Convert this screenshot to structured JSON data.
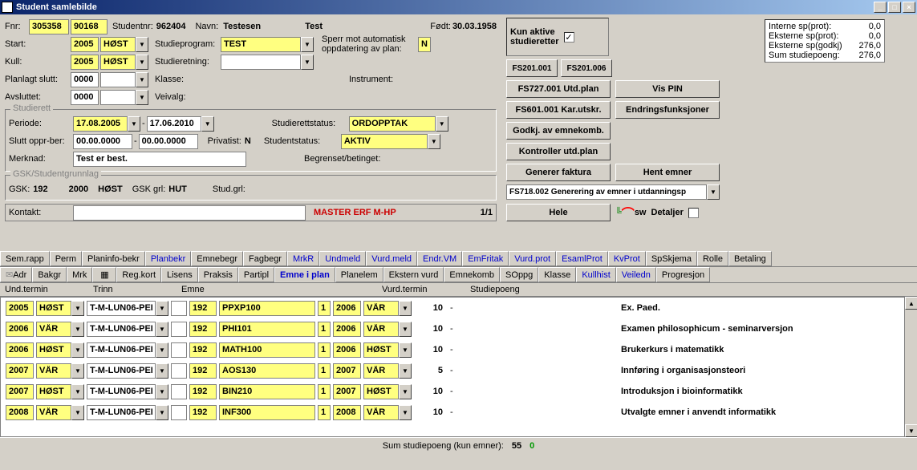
{
  "window": {
    "title": "Student samlebilde"
  },
  "header": {
    "fnr_label": "Fnr:",
    "fnr1": "305358",
    "fnr2": "90168",
    "studentnr_label": "Studentnr:",
    "studentnr": "962404",
    "navn_label": "Navn:",
    "etternavn": "Testesen",
    "fornavn": "Test",
    "fodt_label": "Født:",
    "fodt": "30.03.1958",
    "start_label": "Start:",
    "start_year": "2005",
    "start_term": "HØST",
    "studieprogram_label": "Studieprogram:",
    "studieprogram": "TEST",
    "sperr_label": "Sperr mot automatisk oppdatering av plan:",
    "sperr_val": "N",
    "kull_label": "Kull:",
    "kull_year": "2005",
    "kull_term": "HØST",
    "studieretning_label": "Studieretning:",
    "planlagt_label": "Planlagt slutt:",
    "planlagt_year": "0000",
    "klasse_label": "Klasse:",
    "instrument_label": "Instrument:",
    "avsluttet_label": "Avsluttet:",
    "avsluttet_year": "0000",
    "veivalg_label": "Veivalg:"
  },
  "studierett": {
    "legend": "Studierett",
    "periode_label": "Periode:",
    "periode_from": "17.08.2005",
    "periode_to": "17.06.2010",
    "studierettstatus_label": "Studierettstatus:",
    "studierettstatus": "ORDOPPTAK",
    "slutt_label": "Slutt oppr-ber:",
    "slutt_from": "00.00.0000",
    "slutt_to": "00.00.0000",
    "privatist_label": "Privatist:",
    "privatist": "N",
    "studentstatus_label": "Studentstatus:",
    "studentstatus": "AKTIV",
    "merknad_label": "Merknad:",
    "merknad": "Test er best.",
    "begrenset_label": "Begrenset/betinget:"
  },
  "gsk": {
    "legend": "GSK/Studentgrunnlag",
    "gsk_label": "GSK:",
    "gsk_val": "192",
    "gsk_year": "2000",
    "gsk_term": "HØST",
    "gsk_grl_label": "GSK grl:",
    "gsk_grl": "HUT",
    "stud_grl_label": "Stud.grl:"
  },
  "kontakt": {
    "label": "Kontakt:",
    "master": "MASTER ERF M-HP",
    "count": "1/1"
  },
  "kun_aktive": {
    "label1": "Kun aktive",
    "label2": "studieretter",
    "checked": "✓"
  },
  "stats": {
    "interne_sp_prot": "Interne sp(prot):",
    "interne_val": "0,0",
    "eksterne_sp_prot": "Eksterne sp(prot):",
    "eksterne_prot_val": "0,0",
    "eksterne_sp_godkj": "Eksterne sp(godkj)",
    "eksterne_godkj_val": "276,0",
    "sum_label": "Sum studiepoeng:",
    "sum_val": "276,0"
  },
  "buttons": {
    "fs201_001": "FS201.001",
    "fs201_006": "FS201.006",
    "fs727": "FS727.001 Utd.plan",
    "vis_pin": "Vis PIN",
    "fs601": "FS601.001 Kar.utskr.",
    "endrings": "Endringsfunksjoner",
    "godkj": "Godkj. av emnekomb.",
    "kontroller": "Kontroller utd.plan",
    "generer_faktura": "Generer faktura",
    "hent_emner": "Hent emner",
    "fs718": "FS718.002 Generering av emner i utdanningsp",
    "hele": "Hele",
    "detaljer": "Detaljer"
  },
  "tabs1": [
    "Sem.rapp",
    "Perm",
    "Planinfo-bekr",
    "Planbekr",
    "Emnebegr",
    "Fagbegr",
    "MrkR",
    "Undmeld",
    "Vurd.meld",
    "Endr.VM",
    "EmFritak",
    "Vurd.prot",
    "EsamlProt",
    "KvProt",
    "SpSkjema",
    "Rolle",
    "Betaling"
  ],
  "tabs1_blue": [
    3,
    6,
    7,
    8,
    9,
    10,
    11,
    12,
    13
  ],
  "tabs2_pre": "Adr",
  "tabs2": [
    "Bakgr",
    "Mrk",
    "",
    "Reg.kort",
    "Lisens",
    "Praksis",
    "Partipl",
    "Emne i plan",
    "Planelem",
    "Ekstern vurd",
    "Emnekomb",
    "SOppg",
    "Klasse",
    "Kullhist",
    "Veiledn",
    "Progresjon"
  ],
  "tabs2_active": 7,
  "grid": {
    "headers": {
      "und_termin": "Und.termin",
      "trinn": "Trinn",
      "emne": "Emne",
      "vurd_termin": "Vurd.termin",
      "studiepoeng": "Studiepoeng"
    },
    "rows": [
      {
        "year": "2005",
        "term": "HØST",
        "trinn": "T-M-LUN06-PEI",
        "emnenum": "192",
        "emne": "PPXP100",
        "v": "1",
        "vyear": "2006",
        "vterm": "VÅR",
        "sp": "10",
        "dash": "-",
        "desc": "Ex. Paed."
      },
      {
        "year": "2006",
        "term": "VÅR",
        "trinn": "T-M-LUN06-PEI",
        "emnenum": "192",
        "emne": "PHI101",
        "v": "1",
        "vyear": "2006",
        "vterm": "VÅR",
        "sp": "10",
        "dash": "-",
        "desc": "Examen philosophicum - seminarversjon"
      },
      {
        "year": "2006",
        "term": "HØST",
        "trinn": "T-M-LUN06-PEI",
        "emnenum": "192",
        "emne": "MATH100",
        "v": "1",
        "vyear": "2006",
        "vterm": "HØST",
        "sp": "10",
        "dash": "-",
        "desc": "Brukerkurs i matematikk"
      },
      {
        "year": "2007",
        "term": "VÅR",
        "trinn": "T-M-LUN06-PEI",
        "emnenum": "192",
        "emne": "AOS130",
        "v": "1",
        "vyear": "2007",
        "vterm": "VÅR",
        "sp": "5",
        "dash": "-",
        "desc": "Innføring i organisasjonsteori"
      },
      {
        "year": "2007",
        "term": "HØST",
        "trinn": "T-M-LUN06-PEI",
        "emnenum": "192",
        "emne": "BIN210",
        "v": "1",
        "vyear": "2007",
        "vterm": "HØST",
        "sp": "10",
        "dash": "-",
        "desc": "Introduksjon i bioinformatikk"
      },
      {
        "year": "2008",
        "term": "VÅR",
        "trinn": "T-M-LUN06-PEI",
        "emnenum": "192",
        "emne": "INF300",
        "v": "1",
        "vyear": "2008",
        "vterm": "VÅR",
        "sp": "10",
        "dash": "-",
        "desc": "Utvalgte emner i anvendt informatikk"
      }
    ],
    "footer_label": "Sum studiepoeng (kun emner):",
    "footer_val": "55",
    "footer_zero": "0"
  }
}
